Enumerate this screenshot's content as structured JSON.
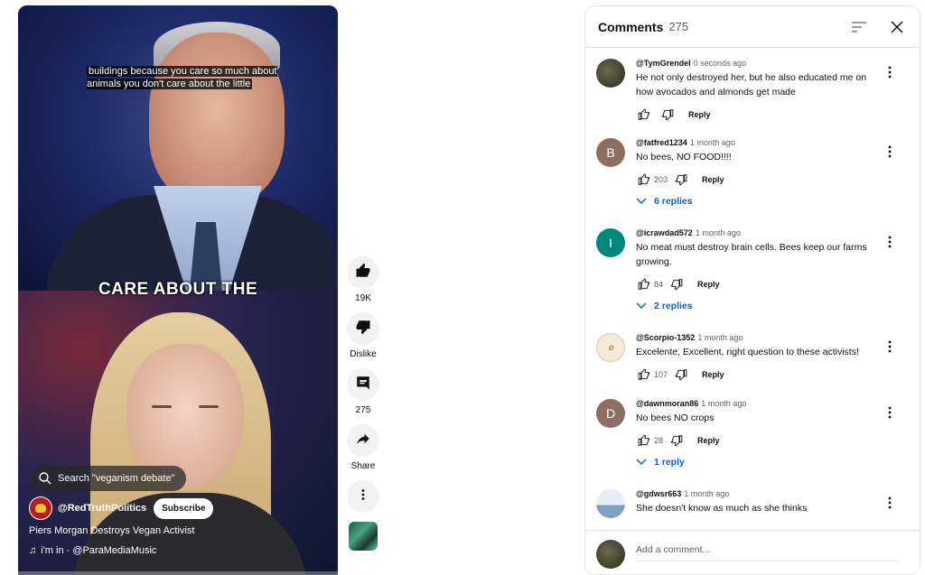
{
  "video": {
    "subtitle_text": "buildings because you care so much about animals you don't care about the little",
    "caption_big": "CARE ABOUT THE",
    "search_pill": "Search \"veganism debate\"",
    "channel_name": "@RedTruthPolitics",
    "subscribe_label": "Subscribe",
    "title": "Piers Morgan Destroys Vegan Activist",
    "music": "i'm in · @ParaMediaMusic",
    "progress_fraction": 0.0
  },
  "rail": {
    "like_count": "19K",
    "dislike_label": "Dislike",
    "comment_count": "275",
    "share_label": "Share"
  },
  "comments_panel": {
    "title": "Comments",
    "count": "275",
    "add_placeholder": "Add a comment...",
    "reply_label": "Reply",
    "items": [
      {
        "author": "@TymGrendel",
        "time": "0 seconds ago",
        "text": "He not only destroyed her, but he also educated me on how avocados and almonds get made",
        "likes": "",
        "replies": "",
        "avatar": "",
        "avatar_color": "#3a3a2a"
      },
      {
        "author": "@fatfred1234",
        "time": "1 month ago",
        "text": "No bees, NO FOOD!!!!",
        "likes": "203",
        "replies": "6 replies",
        "avatar": "B",
        "avatar_color": "#8d6e63"
      },
      {
        "author": "@icrawdad572",
        "time": "1 month ago",
        "text": "No meat must destroy brain cells. Bees keep our farms growing.",
        "likes": "84",
        "replies": "2 replies",
        "avatar": "I",
        "avatar_color": "#00897b"
      },
      {
        "author": "@Scorpio-1352",
        "time": "1 month ago",
        "text": "Excelente, Excellent, right question to these activists!",
        "likes": "107",
        "replies": "",
        "avatar": "",
        "avatar_color": "#f3ead8"
      },
      {
        "author": "@dawnmoran86",
        "time": "1 month ago",
        "text": "No bees NO crops",
        "likes": "28",
        "replies": "1 reply",
        "avatar": "D",
        "avatar_color": "#8d6e63"
      },
      {
        "author": "@gdwsr663",
        "time": "1 month ago",
        "text": "She doesn't know as much as she thinks",
        "likes": "",
        "replies": "",
        "avatar": "",
        "avatar_color": "#dfe6ee"
      }
    ]
  },
  "icons": [
    "search-icon",
    "like-icon",
    "dislike-icon",
    "comment-icon",
    "share-icon",
    "more-vert-icon",
    "sort-icon",
    "close-icon",
    "chevron-down-icon",
    "music-note-icon"
  ],
  "colors": {
    "link_blue": "#065fd4",
    "progress_red": "#ff0033",
    "text_secondary": "#606060"
  }
}
